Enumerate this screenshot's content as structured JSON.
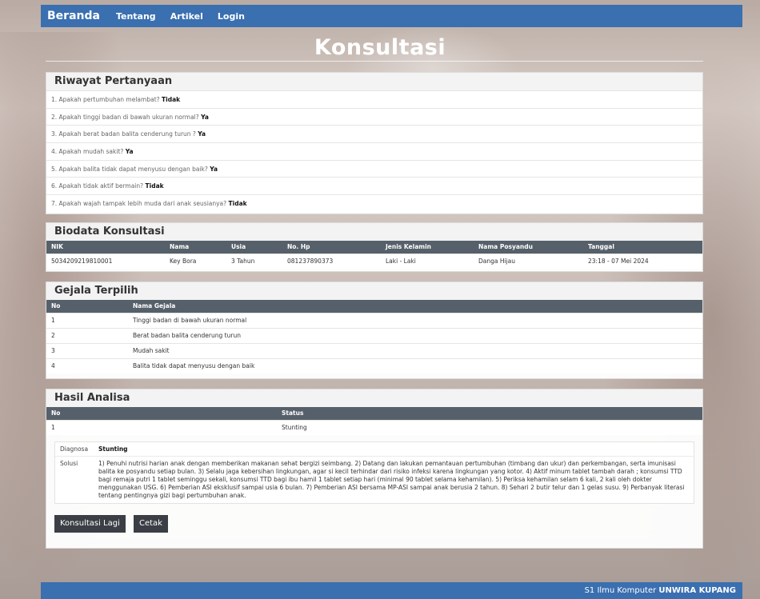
{
  "navbar": {
    "brand": "Beranda",
    "links": [
      "Tentang",
      "Artikel",
      "Login"
    ]
  },
  "page": {
    "title": "Konsultasi"
  },
  "riwayat": {
    "title": "Riwayat Pertanyaan",
    "items": [
      {
        "q": "1. Apakah pertumbuhan melambat?",
        "a": "Tidak"
      },
      {
        "q": "2. Apakah tinggi badan di bawah ukuran normal?",
        "a": "Ya"
      },
      {
        "q": "3. Apakah berat badan balita cenderung turun ?",
        "a": "Ya"
      },
      {
        "q": "4. Apakah mudah sakit?",
        "a": "Ya"
      },
      {
        "q": "5. Apakah balita tidak dapat menyusu dengan baik?",
        "a": "Ya"
      },
      {
        "q": "6. Apakah tidak aktif bermain?",
        "a": "Tidak"
      },
      {
        "q": "7. Apakah wajah tampak lebih muda dari anak seusianya?",
        "a": "Tidak"
      }
    ]
  },
  "biodata": {
    "title": "Biodata Konsultasi",
    "headers": [
      "NIK",
      "Nama",
      "Usia",
      "No. Hp",
      "Jenis Kelamin",
      "Nama Posyandu",
      "Tanggal"
    ],
    "row": [
      "5034209219810001",
      "Key Bora",
      "3 Tahun",
      "081237890373",
      "Laki - Laki",
      "Danga Hijau",
      "23:18 - 07 Mei 2024"
    ]
  },
  "gejala": {
    "title": "Gejala Terpilih",
    "headers": [
      "No",
      "Nama Gejala"
    ],
    "rows": [
      [
        "1",
        "Tinggi badan di bawah ukuran normal"
      ],
      [
        "2",
        "Berat badan balita cenderung turun"
      ],
      [
        "3",
        "Mudah sakit"
      ],
      [
        "4",
        "Balita tidak dapat menyusu dengan baik"
      ]
    ]
  },
  "hasil": {
    "title": "Hasil Analisa",
    "headers": [
      "No",
      "Status"
    ],
    "row": [
      "1",
      "Stunting"
    ],
    "diagnosa_label": "Diagnosa",
    "diagnosa_value": "Stunting",
    "solusi_label": "Solusi",
    "solusi_value": "1) Penuhi nutrisi harian anak dengan memberikan makanan sehat bergizi seimbang. 2) Datang dan lakukan pemantauan pertumbuhan (timbang dan ukur) dan perkembangan, serta imunisasi balita ke posyandu setiap bulan. 3) Selalu jaga kebersihan lingkungan, agar si kecil terhindar dari risiko infeksi karena lingkungan yang kotor. 4) Aktif minum tablet tambah darah ; konsumsi TTD bagi remaja putri 1 tablet seminggu sekali, konsumsi TTD bagi ibu hamil 1 tablet setiap hari (minimal 90 tablet selama kehamilan). 5) Periksa kehamilan selam 6 kali, 2 kali oleh dokter menggunakan USG. 6) Pemberian ASI eksklusif sampai usia 6 bulan. 7) Pemberian ASI bersama MP-ASI sampai anak berusia 2 tahun. 8) Sehari 2 butir telur dan 1 gelas susu. 9) Perbanyak literasi tentang pentingnya gizi bagi pertumbuhan anak.",
    "buttons": [
      "Konsultasi Lagi",
      "Cetak"
    ]
  },
  "footer": {
    "text": "S1 Ilmu Komputer ",
    "bold": "UNWIRA KUPANG"
  }
}
